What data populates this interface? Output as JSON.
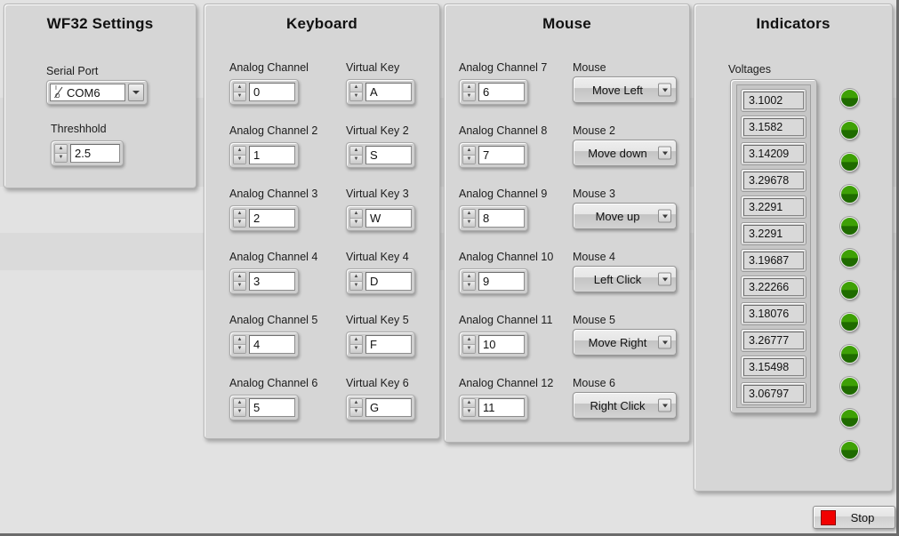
{
  "window": {
    "bg_color": "#e2e2e2"
  },
  "panels": {
    "wf32": {
      "title": "WF32 Settings",
      "serial_port": {
        "label": "Serial Port",
        "value": "COM6",
        "icon": "visa-io-icon",
        "dropdown_icon": "chevron-down-icon"
      },
      "threshhold": {
        "label": "Threshhold",
        "value": "2.5",
        "spinner_up_icon": "triangle-up-icon",
        "spinner_down_icon": "triangle-down-icon"
      }
    },
    "keyboard": {
      "title": "Keyboard",
      "rows": [
        {
          "channel_label": "Analog Channel",
          "channel_value": "0",
          "key_label": "Virtual Key",
          "key_value": "A"
        },
        {
          "channel_label": "Analog Channel 2",
          "channel_value": "1",
          "key_label": "Virtual Key 2",
          "key_value": "S"
        },
        {
          "channel_label": "Analog Channel 3",
          "channel_value": "2",
          "key_label": "Virtual Key 3",
          "key_value": "W"
        },
        {
          "channel_label": "Analog Channel 4",
          "channel_value": "3",
          "key_label": "Virtual Key 4",
          "key_value": "D"
        },
        {
          "channel_label": "Analog Channel 5",
          "channel_value": "4",
          "key_label": "Virtual Key 5",
          "key_value": "F"
        },
        {
          "channel_label": "Analog Channel 6",
          "channel_value": "5",
          "key_label": "Virtual Key 6",
          "key_value": "G"
        }
      ]
    },
    "mouse": {
      "title": "Mouse",
      "rows": [
        {
          "channel_label": "Analog Channel 7",
          "channel_value": "6",
          "action_label": "Mouse",
          "action_value": "Move Left"
        },
        {
          "channel_label": "Analog Channel 8",
          "channel_value": "7",
          "action_label": "Mouse 2",
          "action_value": "Move down"
        },
        {
          "channel_label": "Analog Channel 9",
          "channel_value": "8",
          "action_label": "Mouse 3",
          "action_value": "Move up"
        },
        {
          "channel_label": "Analog Channel 10",
          "channel_value": "9",
          "action_label": "Mouse 4",
          "action_value": "Left Click"
        },
        {
          "channel_label": "Analog Channel 11",
          "channel_value": "10",
          "action_label": "Mouse 5",
          "action_value": "Move Right"
        },
        {
          "channel_label": "Analog Channel 12",
          "channel_value": "11",
          "action_label": "Mouse 6",
          "action_value": "Right Click"
        }
      ]
    },
    "indicators": {
      "title": "Indicators",
      "voltages_label": "Voltages",
      "voltages": [
        "3.1002",
        "3.1582",
        "3.14209",
        "3.29678",
        "3.2291",
        "3.2291",
        "3.19687",
        "3.22266",
        "3.18076",
        "3.26777",
        "3.15498",
        "3.06797"
      ],
      "led_count": 12,
      "led_color": "#3ea006",
      "led_icon": "led-indicator-icon"
    }
  },
  "stop_button": {
    "label": "Stop",
    "icon": "stop-square-icon",
    "icon_color": "#f20000"
  }
}
